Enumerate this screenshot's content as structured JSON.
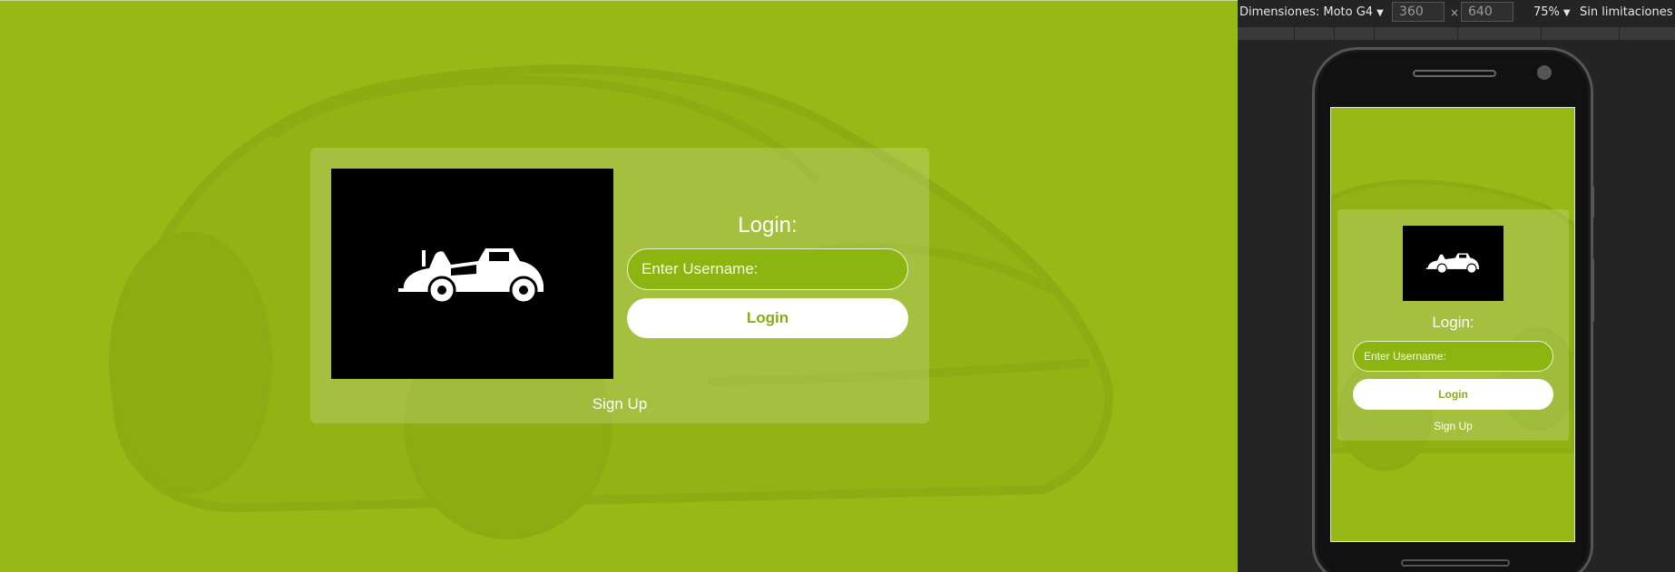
{
  "desktop": {
    "title": "Login:",
    "username_placeholder": "Enter Username:",
    "login_button": "Login",
    "signup_link": "Sign Up"
  },
  "devtools": {
    "device_label": "Dimensiones: Moto G4",
    "width_value": "360",
    "height_value": "640",
    "separator": "×",
    "zoom": "75%",
    "throttling": "Sin limitaciones"
  },
  "mobile": {
    "title": "Login:",
    "username_placeholder": "Enter Username:",
    "login_button": "Login",
    "signup_link": "Sign Up"
  },
  "colors": {
    "page_background": "#97b916",
    "input_fill": "#8db512",
    "button_text": "#86ad10",
    "devtools_background": "#242424"
  },
  "icons": {
    "logo": "vintage-car-icon",
    "background": "sports-car-illustration"
  }
}
